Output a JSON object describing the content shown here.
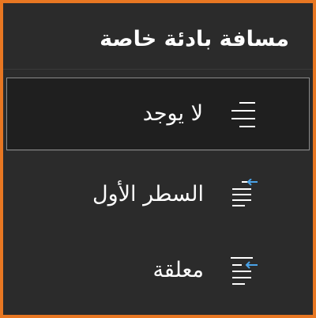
{
  "panel": {
    "title": "مسافة بادئة خاصة"
  },
  "options": [
    {
      "label": "لا يوجد",
      "icon": "indent-none-icon",
      "selected": true
    },
    {
      "label": "السطر الأول",
      "icon": "indent-first-line-icon",
      "selected": false
    },
    {
      "label": "معلقة",
      "icon": "indent-hanging-icon",
      "selected": false
    }
  ],
  "colors": {
    "accent_border": "#e87722",
    "background": "#2b2b2b",
    "selected_background": "#1f1f1f",
    "arrow": "#4aa3e8",
    "text": "#ffffff"
  }
}
